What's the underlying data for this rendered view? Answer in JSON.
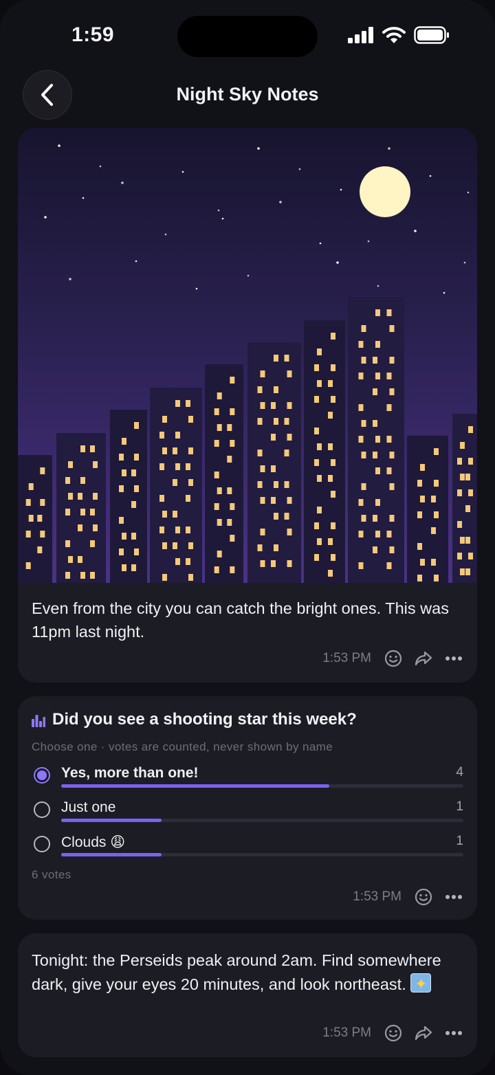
{
  "status_bar": {
    "time": "1:59"
  },
  "header": {
    "title": "Night Sky Notes"
  },
  "posts": {
    "photo": {
      "caption": "Even from the city you can catch the bright ones. This was 11pm last night.",
      "time": "1:53 PM"
    },
    "poll": {
      "title": "Did you see a shooting star this week?",
      "subtitle": "Choose one · votes are counted, never shown by name",
      "options": [
        {
          "label": "Yes, more than one!",
          "count": "4",
          "fraction": 0.667,
          "selected": true
        },
        {
          "label": "Just one",
          "count": "1",
          "fraction": 0.25,
          "selected": false
        },
        {
          "label": "Clouds 😩",
          "count": "1",
          "fraction": 0.25,
          "selected": false
        }
      ],
      "total": "6 votes",
      "time": "1:53 PM"
    },
    "note": {
      "text": "Tonight: the Perseids peak around 2am. Find somewhere dark, give your eyes 20 minutes, and look northeast.",
      "emoji_icon": "shooting-star-emoji",
      "time": "1:53 PM"
    }
  },
  "colors": {
    "accent": "#7b62f0",
    "card": "#1c1c25",
    "background": "#111118",
    "window_light": "#f4c97a",
    "moon": "#fff4c4"
  }
}
